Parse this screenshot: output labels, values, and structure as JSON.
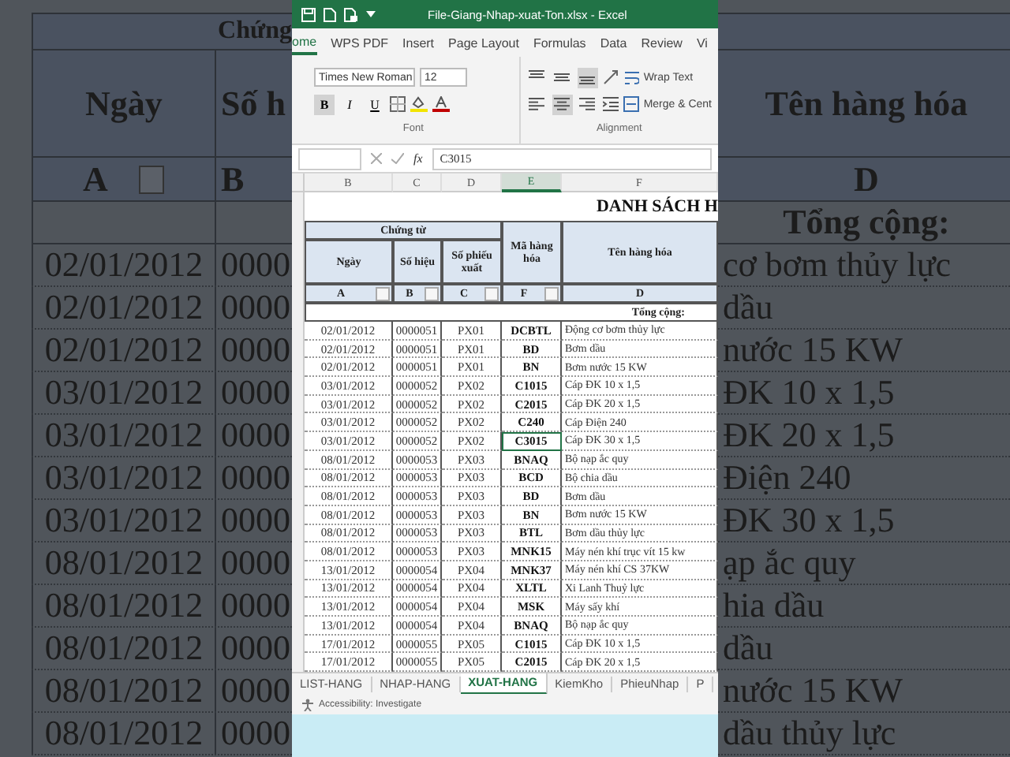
{
  "background_left": {
    "group_header": "Chứng",
    "headers": [
      "Ngày",
      "Số h"
    ],
    "filter_labels": [
      {
        "label": "A",
        "filter": true
      },
      {
        "label": "B",
        "filter": false
      }
    ],
    "rows": [
      {
        "date": "02/01/2012",
        "number": "0000"
      },
      {
        "date": "02/01/2012",
        "number": "0000"
      },
      {
        "date": "02/01/2012",
        "number": "0000"
      },
      {
        "date": "03/01/2012",
        "number": "0000"
      },
      {
        "date": "03/01/2012",
        "number": "0000"
      },
      {
        "date": "03/01/2012",
        "number": "0000"
      },
      {
        "date": "03/01/2012",
        "number": "0000"
      },
      {
        "date": "08/01/2012",
        "number": "0000"
      },
      {
        "date": "08/01/2012",
        "number": "0000"
      },
      {
        "date": "08/01/2012",
        "number": "0000"
      },
      {
        "date": "08/01/2012",
        "number": "0000"
      },
      {
        "date": "08/01/2012",
        "number": "0000"
      }
    ]
  },
  "background_right": {
    "header": "Tên hàng hóa",
    "filter_label": "D",
    "total_label": "Tổng cộng:",
    "rows": [
      "cơ bơm thủy lực",
      "dầu",
      "nước 15 KW",
      "ĐK 10 x 1,5",
      "ĐK 20 x 1,5",
      "Điện 240",
      "ĐK 30 x 1,5",
      "ạp ắc quy",
      "hia dầu",
      "dầu",
      "nước 15 KW",
      "dầu thủy lực"
    ]
  },
  "window": {
    "title": "File-Giang-Nhap-xuat-Ton.xlsx - Excel"
  },
  "ribbon_tabs": [
    {
      "label": "ome",
      "selected": true
    },
    {
      "label": "WPS PDF",
      "selected": false
    },
    {
      "label": "Insert",
      "selected": false
    },
    {
      "label": "Page Layout",
      "selected": false
    },
    {
      "label": "Formulas",
      "selected": false
    },
    {
      "label": "Data",
      "selected": false
    },
    {
      "label": "Review",
      "selected": false
    },
    {
      "label": "Vi",
      "selected": false
    }
  ],
  "ribbon": {
    "font_name": "Times New Roman",
    "font_size": "12",
    "format_buttons": [
      {
        "label": "B",
        "selected": true
      },
      {
        "label": "I",
        "selected": false
      },
      {
        "label": "U",
        "selected": false
      }
    ],
    "vertical_align": [
      {
        "kind": "top",
        "selected": false
      },
      {
        "kind": "middle",
        "selected": false
      },
      {
        "kind": "bottom",
        "selected": true
      }
    ],
    "horizontal_align": [
      {
        "kind": "left",
        "selected": false
      },
      {
        "kind": "center",
        "selected": true
      },
      {
        "kind": "right",
        "selected": false
      }
    ],
    "wrap_text": "Wrap Text",
    "merge": "Merge & Cent",
    "groups": [
      "Font",
      "Alignment"
    ]
  },
  "formula_bar": {
    "fx": "fx",
    "value": "C3015"
  },
  "sheet": {
    "column_letters": [
      {
        "label": "B",
        "selected": false
      },
      {
        "label": "C",
        "selected": false
      },
      {
        "label": "D",
        "selected": false
      },
      {
        "label": "E",
        "selected": true
      },
      {
        "label": "F",
        "selected": false
      }
    ],
    "title": "DANH SÁCH H",
    "group_header": "Chứng từ",
    "headers": [
      "Ngày",
      "Số hiệu",
      "Số phiếu xuất",
      "Mã hàng hóa",
      "Tên hàng hóa"
    ],
    "filter_labels": [
      {
        "label": "A",
        "filter": true
      },
      {
        "label": "B",
        "filter": true
      },
      {
        "label": "C",
        "filter": true
      },
      {
        "label": "F",
        "filter": true
      },
      {
        "label": "D",
        "filter": false
      }
    ],
    "total_label": "Tổng cộng:",
    "rows": [
      {
        "date": "02/01/2012",
        "voucher": "0000051",
        "slip": "PX01",
        "code": "DCBTL",
        "name": "Động cơ bơm thủy lực",
        "selected": false
      },
      {
        "date": "02/01/2012",
        "voucher": "0000051",
        "slip": "PX01",
        "code": "BD",
        "name": "Bơm dầu",
        "selected": false
      },
      {
        "date": "02/01/2012",
        "voucher": "0000051",
        "slip": "PX01",
        "code": "BN",
        "name": "Bơm nước 15 KW",
        "selected": false
      },
      {
        "date": "03/01/2012",
        "voucher": "0000052",
        "slip": "PX02",
        "code": "C1015",
        "name": "Cáp ĐK 10 x 1,5",
        "selected": false
      },
      {
        "date": "03/01/2012",
        "voucher": "0000052",
        "slip": "PX02",
        "code": "C2015",
        "name": "Cáp ĐK 20 x 1,5",
        "selected": false
      },
      {
        "date": "03/01/2012",
        "voucher": "0000052",
        "slip": "PX02",
        "code": "C240",
        "name": "Cáp Điện 240",
        "selected": false
      },
      {
        "date": "03/01/2012",
        "voucher": "0000052",
        "slip": "PX02",
        "code": "C3015",
        "name": "Cáp ĐK 30 x 1,5",
        "selected": true
      },
      {
        "date": "08/01/2012",
        "voucher": "0000053",
        "slip": "PX03",
        "code": "BNAQ",
        "name": "Bộ nạp ắc quy",
        "selected": false
      },
      {
        "date": "08/01/2012",
        "voucher": "0000053",
        "slip": "PX03",
        "code": "BCD",
        "name": "Bộ chia dầu",
        "selected": false
      },
      {
        "date": "08/01/2012",
        "voucher": "0000053",
        "slip": "PX03",
        "code": "BD",
        "name": "Bơm dầu",
        "selected": false
      },
      {
        "date": "08/01/2012",
        "voucher": "0000053",
        "slip": "PX03",
        "code": "BN",
        "name": "Bơm nước 15 KW",
        "selected": false
      },
      {
        "date": "08/01/2012",
        "voucher": "0000053",
        "slip": "PX03",
        "code": "BTL",
        "name": "Bơm dầu thủy lực",
        "selected": false
      },
      {
        "date": "08/01/2012",
        "voucher": "0000053",
        "slip": "PX03",
        "code": "MNK15",
        "name": "Máy nén khí trục vít 15 kw",
        "selected": false
      },
      {
        "date": "13/01/2012",
        "voucher": "0000054",
        "slip": "PX04",
        "code": "MNK37",
        "name": "Máy nén khí CS 37KW",
        "selected": false
      },
      {
        "date": "13/01/2012",
        "voucher": "0000054",
        "slip": "PX04",
        "code": "XLTL",
        "name": "Xi Lanh Thuỷ lực",
        "selected": false
      },
      {
        "date": "13/01/2012",
        "voucher": "0000054",
        "slip": "PX04",
        "code": "MSK",
        "name": "Máy sấy khí",
        "selected": false
      },
      {
        "date": "13/01/2012",
        "voucher": "0000054",
        "slip": "PX04",
        "code": "BNAQ",
        "name": "Bộ nạp ắc quy",
        "selected": false
      },
      {
        "date": "17/01/2012",
        "voucher": "0000055",
        "slip": "PX05",
        "code": "C1015",
        "name": "Cáp ĐK 10 x 1,5",
        "selected": false
      },
      {
        "date": "17/01/2012",
        "voucher": "0000055",
        "slip": "PX05",
        "code": "C2015",
        "name": "Cáp ĐK 20 x 1,5",
        "selected": false
      }
    ]
  },
  "sheet_tabs": [
    {
      "label": "LIST-HANG",
      "selected": false
    },
    {
      "label": "NHAP-HANG",
      "selected": false
    },
    {
      "label": "XUAT-HANG",
      "selected": true
    },
    {
      "label": "KiemKho",
      "selected": false
    },
    {
      "label": "PhieuNhap",
      "selected": false
    },
    {
      "label": "P",
      "selected": false
    }
  ],
  "status_bar": {
    "text": "Accessibility: Investigate"
  }
}
